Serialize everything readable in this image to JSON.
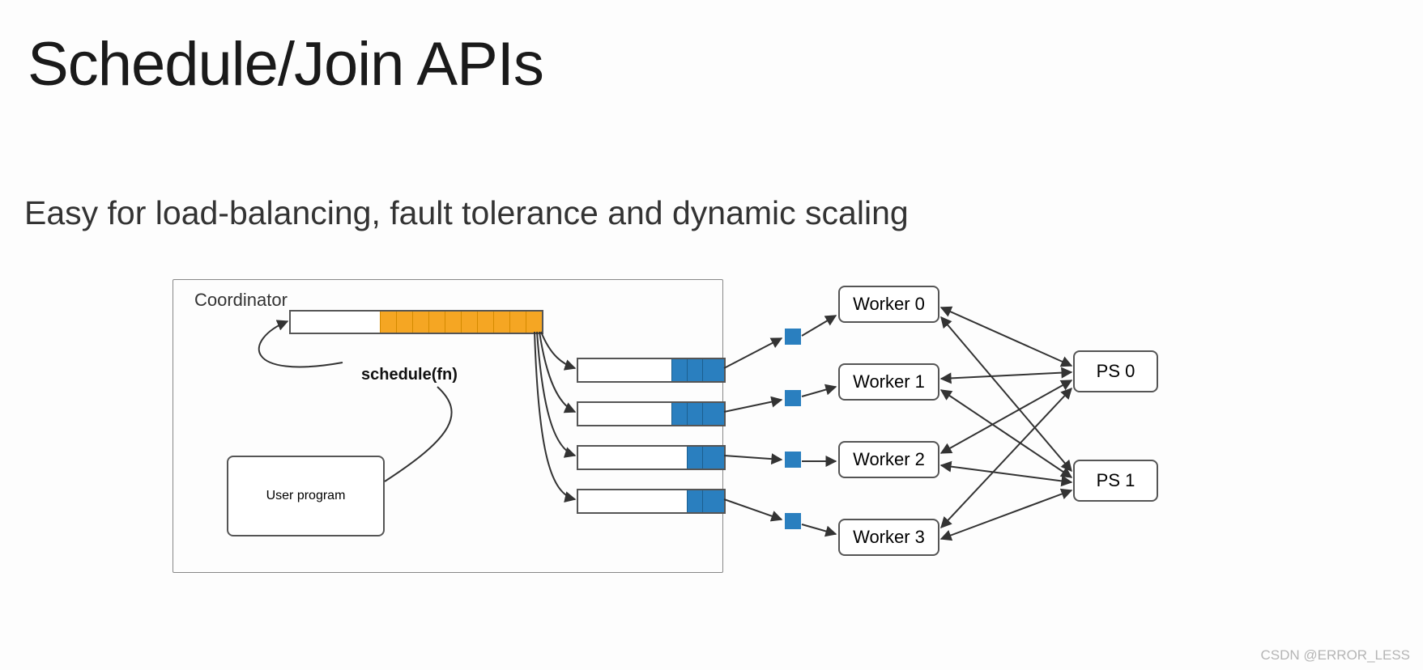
{
  "title": "Schedule/Join APIs",
  "subtitle": "Easy for load-balancing, fault tolerance and dynamic scaling",
  "coordinator_label": "Coordinator",
  "user_program_label": "User program",
  "schedule_fn_label": "schedule(fn)",
  "workers": [
    "Worker 0",
    "Worker 1",
    "Worker 2",
    "Worker 3"
  ],
  "ps": [
    "PS 0",
    "PS 1"
  ],
  "watermark": "CSDN @ERROR_LESS",
  "colors": {
    "task_pending": "#f5a623",
    "task_dispatched": "#2a7fbf",
    "border": "#555555"
  }
}
